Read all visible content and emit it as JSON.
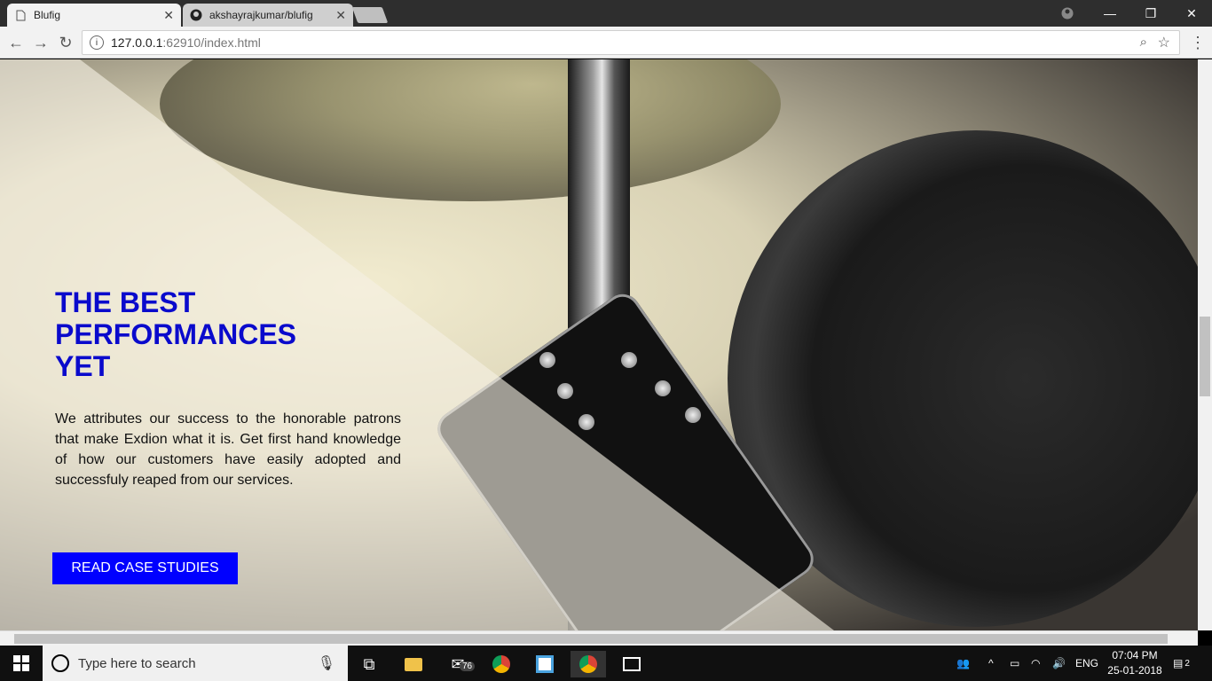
{
  "browser": {
    "tabs": [
      {
        "title": "Blufig",
        "active": true
      },
      {
        "title": "akshayrajkumar/blufig",
        "active": false
      }
    ],
    "url_host": "127.0.0.1",
    "url_rest": ":62910/index.html"
  },
  "hero": {
    "headline_lines": [
      "THE BEST",
      "PERFORMANCES",
      "YET"
    ],
    "body": "We attributes our success to the honorable patrons that make Exdion what it is. Get first hand knowledge of how our customers have easily adopted and successfuly reaped from our services.",
    "cta_label": "READ CASE STUDIES",
    "accent_color": "#0000ff",
    "headline_color": "#0a0acc"
  },
  "taskbar": {
    "search_placeholder": "Type here to search",
    "mail_badge": "76",
    "language": "ENG",
    "time": "07:04 PM",
    "date": "25-01-2018",
    "notifications_count": "2"
  }
}
